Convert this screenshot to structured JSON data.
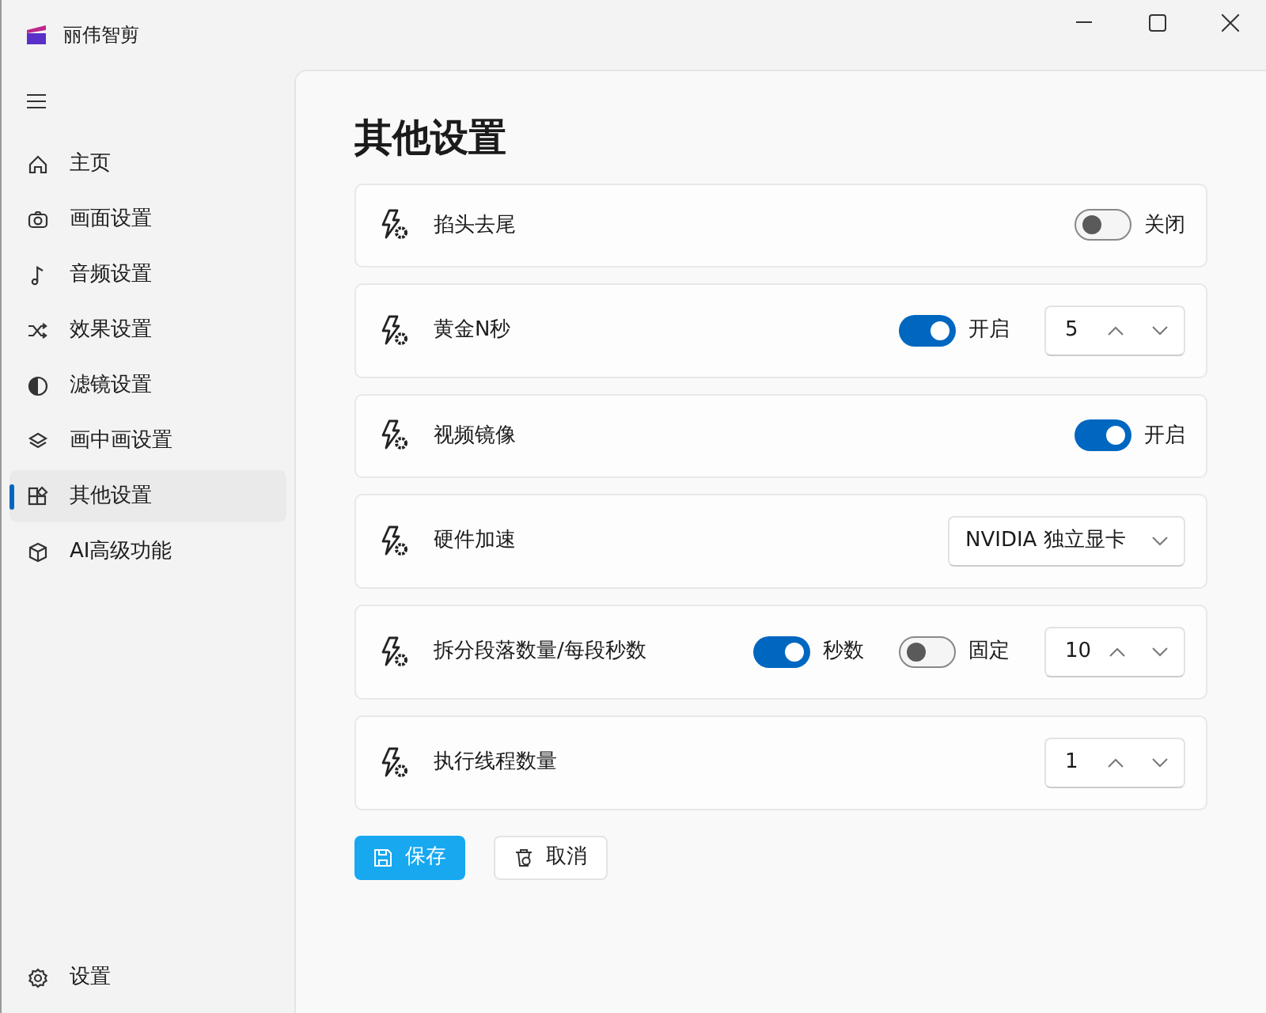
{
  "app": {
    "title": "丽伟智剪"
  },
  "sidebar": {
    "items": [
      {
        "label": "主页",
        "selected": false
      },
      {
        "label": "画面设置",
        "selected": false
      },
      {
        "label": "音频设置",
        "selected": false
      },
      {
        "label": "效果设置",
        "selected": false
      },
      {
        "label": "滤镜设置",
        "selected": false
      },
      {
        "label": "画中画设置",
        "selected": false
      },
      {
        "label": "其他设置",
        "selected": true
      },
      {
        "label": "AI高级功能",
        "selected": false
      }
    ],
    "footer": {
      "label": "设置"
    }
  },
  "page": {
    "title": "其他设置"
  },
  "rows": [
    {
      "label": "掐头去尾",
      "controls": [
        {
          "kind": "toggle",
          "on": false,
          "text": "关闭"
        }
      ]
    },
    {
      "label": "黄金N秒",
      "controls": [
        {
          "kind": "toggle",
          "on": true,
          "text": "开启"
        },
        {
          "kind": "spin",
          "value": "5"
        }
      ]
    },
    {
      "label": "视频镜像",
      "controls": [
        {
          "kind": "toggle",
          "on": true,
          "text": "开启"
        }
      ]
    },
    {
      "label": "硬件加速",
      "controls": [
        {
          "kind": "select",
          "value": "NVIDIA 独立显卡"
        }
      ]
    },
    {
      "label": "拆分段落数量/每段秒数",
      "controls": [
        {
          "kind": "toggle",
          "on": true,
          "text": "秒数"
        },
        {
          "kind": "toggle",
          "on": false,
          "text": "固定"
        },
        {
          "kind": "spin",
          "value": "10"
        }
      ]
    },
    {
      "label": "执行线程数量",
      "controls": [
        {
          "kind": "spin",
          "value": "1"
        }
      ]
    }
  ],
  "actions": [
    {
      "label": "保存",
      "kind": "primary"
    },
    {
      "label": "取消",
      "kind": "secondary"
    }
  ]
}
